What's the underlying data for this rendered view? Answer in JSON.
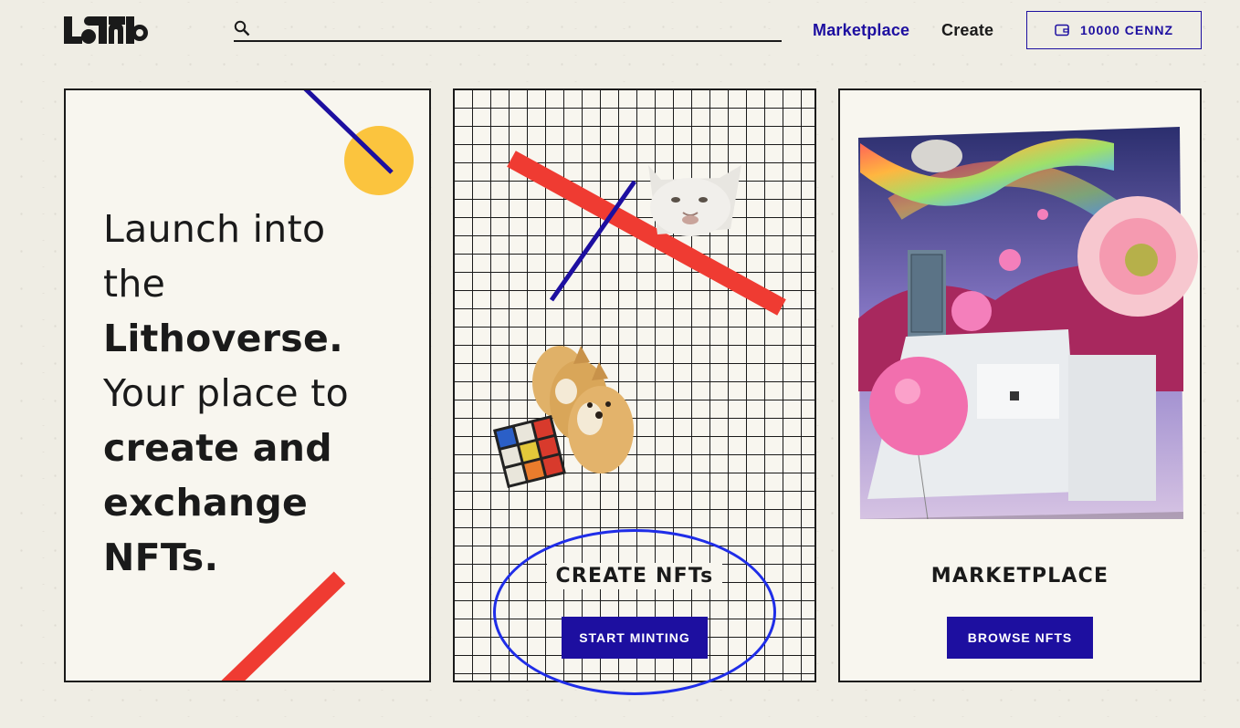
{
  "header": {
    "search_placeholder": "",
    "nav_marketplace": "Marketplace",
    "nav_create": "Create",
    "wallet_balance": "10000 CENNZ"
  },
  "hero": {
    "line1": "Launch into",
    "line2": "the",
    "line3": "Lithoverse.",
    "line4": "Your place to",
    "line5": "create and",
    "line6": "exchange",
    "line7": "NFTs."
  },
  "create_card": {
    "title": "CREATE NFTs",
    "button": "START MINTING"
  },
  "market_card": {
    "title": "MARKETPLACE",
    "button": "BROWSE NFTS"
  },
  "colors": {
    "accent": "#1d0fa0",
    "red": "#ef3b32",
    "yellow": "#fbc43e",
    "annotation": "#1f2de8"
  }
}
